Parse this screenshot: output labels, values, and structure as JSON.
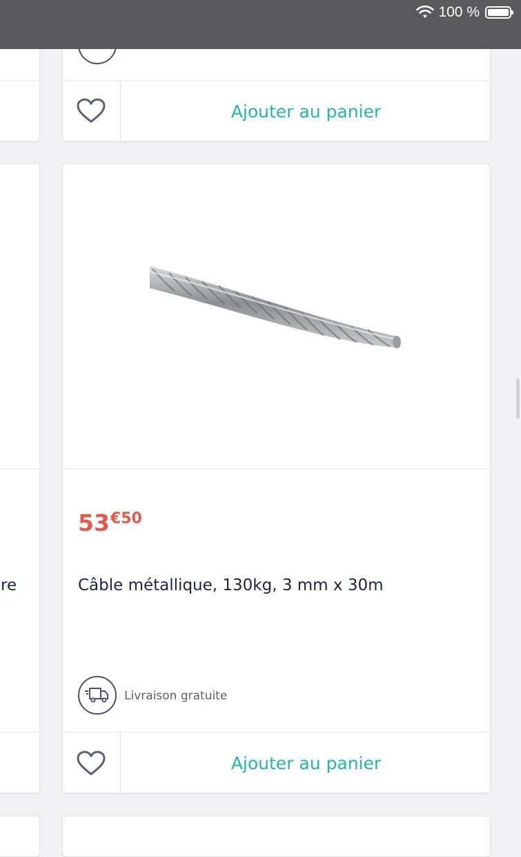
{
  "status_bar": {
    "battery_text": "100 %"
  },
  "cards": {
    "top": {
      "add_to_cart_label": "Ajouter au panier"
    },
    "main": {
      "price_int": "53",
      "price_dec": "€50",
      "title": "Câble métallique, 130kg, 3 mm x 30m",
      "delivery_label": "Livraison gratuite",
      "add_to_cart_label": "Ajouter au panier",
      "image_alt": "steel-wire-cable"
    },
    "left": {
      "partial_text": "re"
    }
  },
  "colors": {
    "accent": "#26b5a8",
    "price": "#e35a4b",
    "title": "#1c2540",
    "status_bar": "#5a5a5c"
  }
}
